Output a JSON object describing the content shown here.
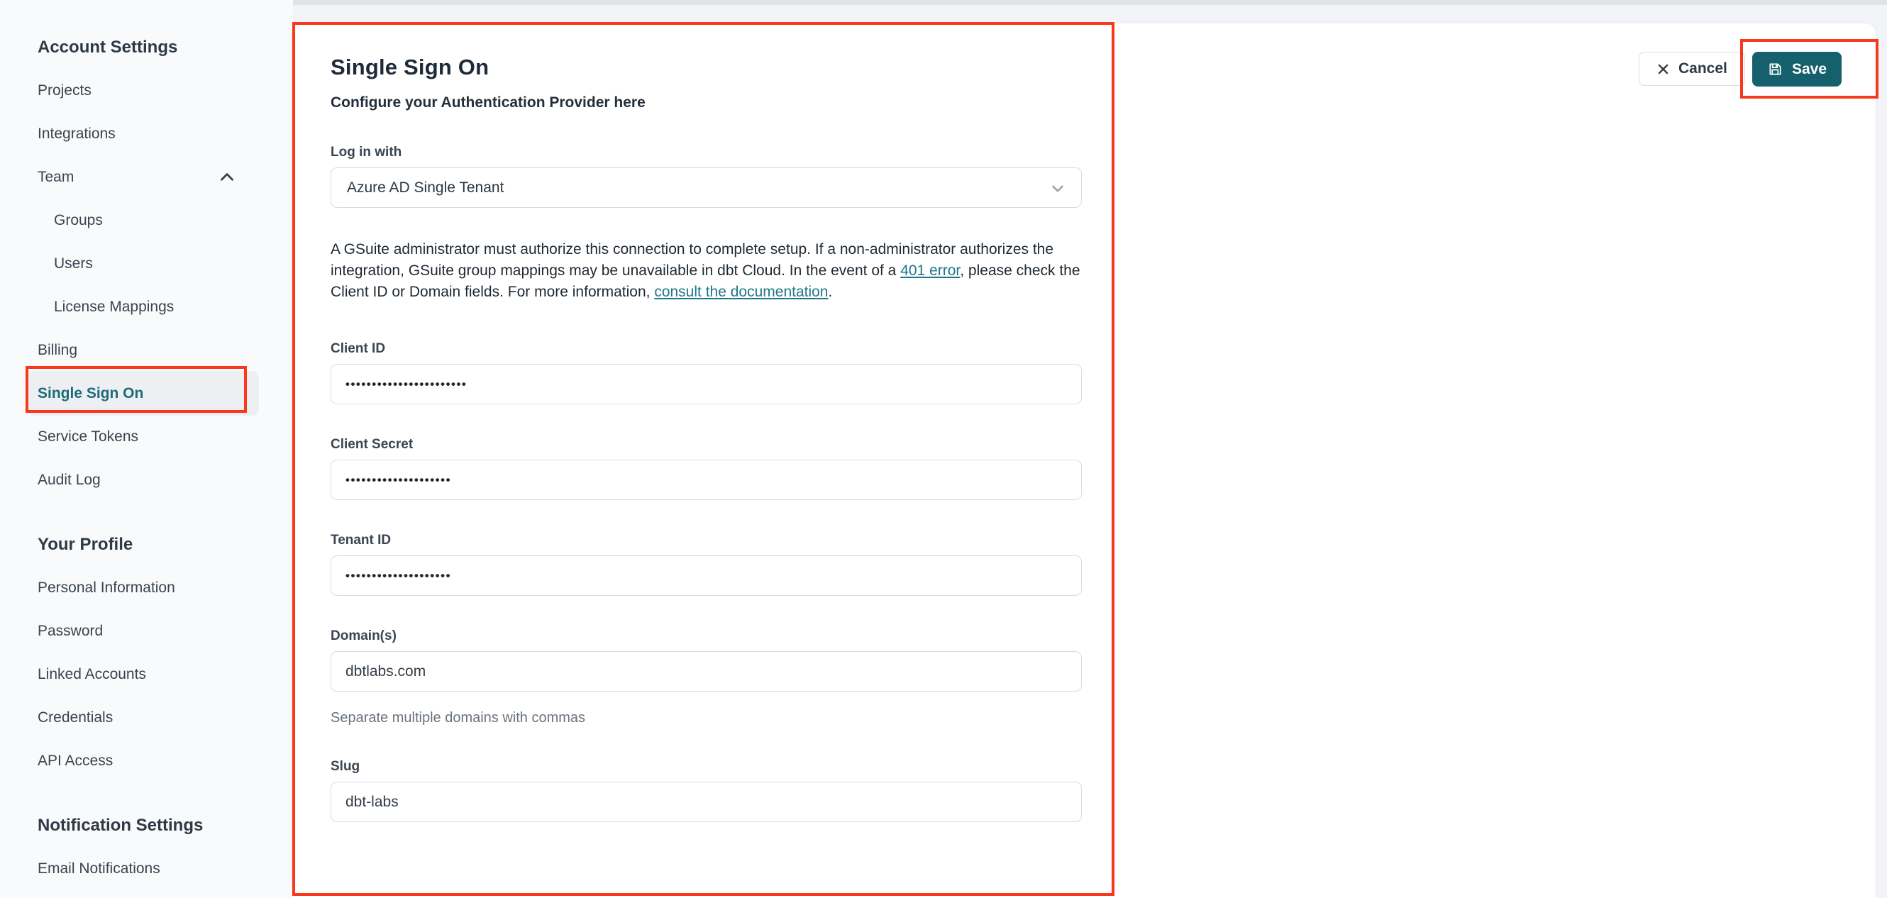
{
  "theme": {
    "accent_teal": "#15606c",
    "link_teal": "#20778a",
    "annotation_red": "#f7381c",
    "active_item_teal": "#1d6b78"
  },
  "sidebar": {
    "items": [
      {
        "label": "Account Settings",
        "type": "header"
      },
      {
        "label": "Projects",
        "type": "item"
      },
      {
        "label": "Integrations",
        "type": "item"
      },
      {
        "label": "Team",
        "type": "item",
        "icon": "chevron-up"
      },
      {
        "label": "Groups",
        "type": "subitem"
      },
      {
        "label": "Users",
        "type": "subitem"
      },
      {
        "label": "License Mappings",
        "type": "subitem"
      },
      {
        "label": "Billing",
        "type": "item"
      },
      {
        "label": "Single Sign On",
        "type": "item",
        "active": true,
        "annotated": true
      },
      {
        "label": "Service Tokens",
        "type": "item"
      },
      {
        "label": "Audit Log",
        "type": "item"
      },
      {
        "label": "Your Profile",
        "type": "header",
        "section_gap": true
      },
      {
        "label": "Personal Information",
        "type": "item"
      },
      {
        "label": "Password",
        "type": "item"
      },
      {
        "label": "Linked Accounts",
        "type": "item"
      },
      {
        "label": "Credentials",
        "type": "item"
      },
      {
        "label": "API Access",
        "type": "item"
      },
      {
        "label": "Notification Settings",
        "type": "header",
        "section_gap": true
      },
      {
        "label": "Email Notifications",
        "type": "item"
      }
    ]
  },
  "main": {
    "title": "Single Sign On",
    "subtitle": "Configure your Authentication Provider here",
    "login_with": {
      "label": "Log in with",
      "value": "Azure AD Single Tenant"
    },
    "notice_segments": [
      {
        "text": "A GSuite administrator must authorize this connection to complete setup. If a non-administrator authorizes the integration, GSuite group mappings may be unavailable in dbt Cloud. In the event of a "
      },
      {
        "text": "401 error",
        "link": true
      },
      {
        "text": ", please check the Client ID or Domain fields. For more information, "
      },
      {
        "text": "consult the documentation",
        "link": true
      },
      {
        "text": "."
      }
    ],
    "fields": [
      {
        "label": "Client ID",
        "value": "•••••••••••••••••••••••",
        "masked": true
      },
      {
        "label": "Client Secret",
        "value": "••••••••••••••••••••",
        "masked": true
      },
      {
        "label": "Tenant ID",
        "value": "••••••••••••••••••••",
        "masked": true
      },
      {
        "label": "Domain(s)",
        "value": "dbtlabs.com",
        "helper": "Separate multiple domains with commas"
      },
      {
        "label": "Slug",
        "value": "dbt-labs"
      }
    ],
    "actions": {
      "cancel": "Cancel",
      "save": "Save"
    }
  }
}
